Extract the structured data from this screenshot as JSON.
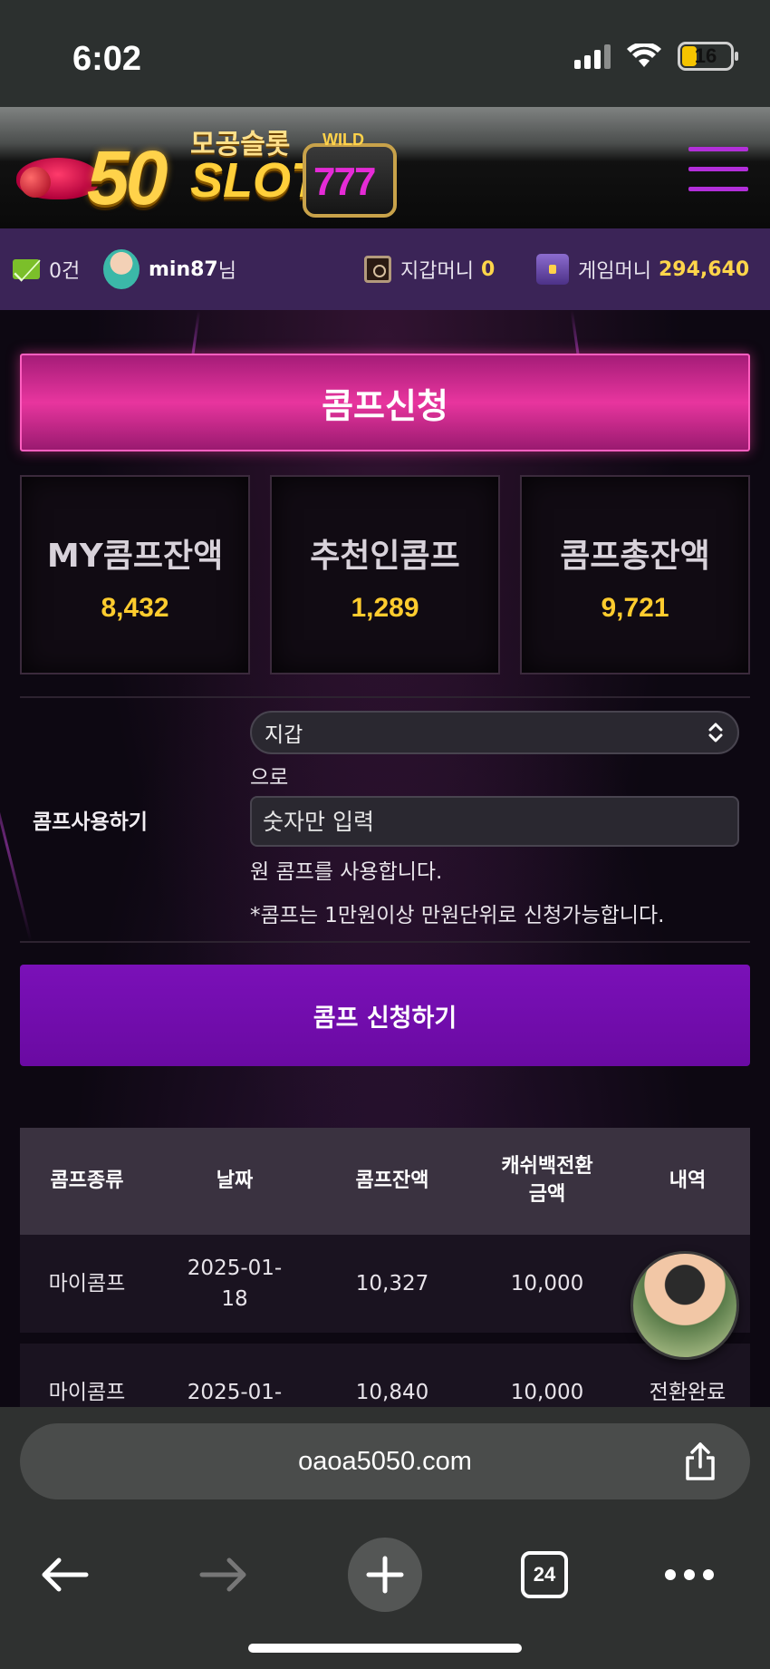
{
  "status_bar": {
    "time": "6:02",
    "battery": "16"
  },
  "site": {
    "logo_number": "50",
    "logo_korean": "모공슬롯",
    "logo_slot": "SLOT",
    "logo_wild": "WILD",
    "logo_sevens": "777"
  },
  "user_bar": {
    "messages": "0건",
    "username": "min87",
    "username_suffix": "님",
    "wallet_label": "지갑머니",
    "wallet_value": "0",
    "game_label": "게임머니",
    "game_value": "294,640"
  },
  "comp": {
    "title": "콤프신청",
    "stats": [
      {
        "label": "MY콤프잔액",
        "value": "8,432"
      },
      {
        "label": "추천인콤프",
        "value": "1,289"
      },
      {
        "label": "콤프총잔액",
        "value": "9,721"
      }
    ],
    "use_label": "콤프사용하기",
    "select_value": "지갑",
    "to_text": "으로",
    "amount_placeholder": "숫자만 입력",
    "use_text": "원 콤프를 사용합니다.",
    "note": "*콤프는 1만원이상 만원단위로 신청가능합니다.",
    "apply_button": "콤프 신청하기"
  },
  "table": {
    "headers": [
      "콤프종류",
      "날짜",
      "콤프잔액",
      "캐쉬백전환\n금액",
      "내역"
    ],
    "rows": [
      {
        "type": "마이콤프",
        "date": "2025-01-\n18",
        "balance": "10,327",
        "amount": "10,000",
        "detail": ""
      },
      {
        "type": "마이콤프",
        "date": "2025-01-",
        "balance": "10,840",
        "amount": "10,000",
        "detail": "전환완료"
      }
    ]
  },
  "browser": {
    "url": "oaoa5050.com",
    "tab_count": "24"
  },
  "colors": {
    "accent_pink": "#e8359e",
    "accent_purple": "#6a0aa2",
    "gold": "#ffcc2e",
    "user_bar": "#3b2457"
  }
}
